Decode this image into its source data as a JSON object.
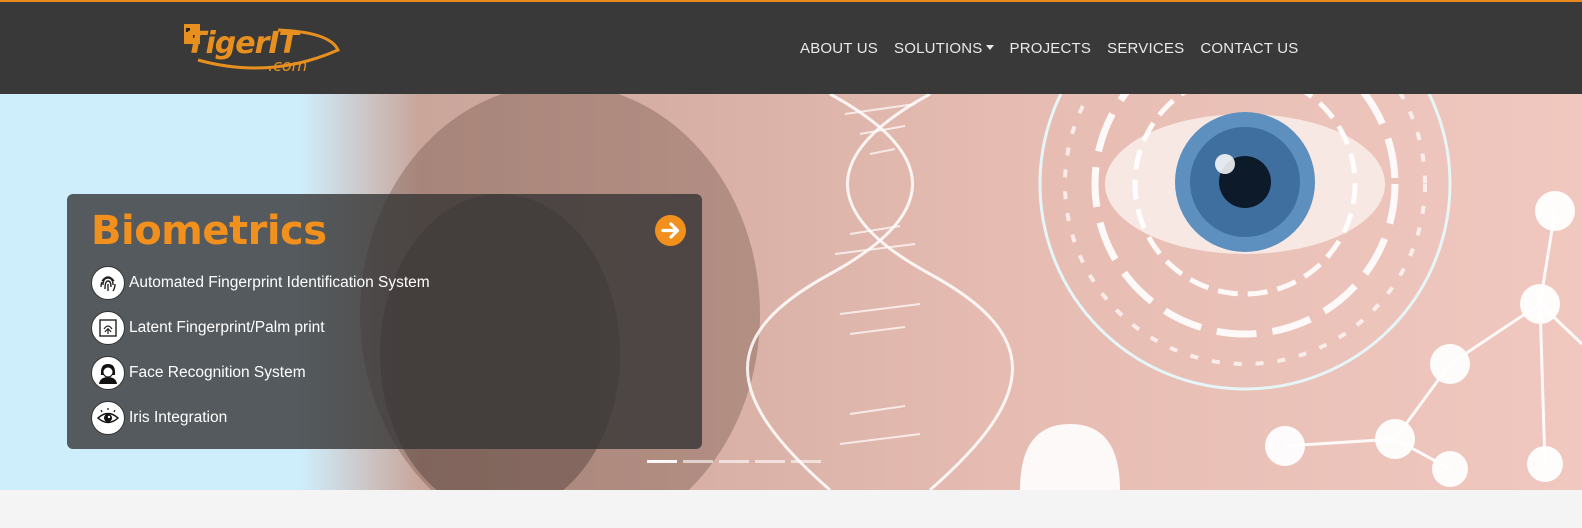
{
  "header": {
    "logo": {
      "text": "TigerIT",
      "sub": ".com"
    },
    "nav": [
      {
        "label": "ABOUT US"
      },
      {
        "label": "SOLUTIONS",
        "dropdown": true
      },
      {
        "label": "PROJECTS"
      },
      {
        "label": "SERVICES"
      },
      {
        "label": "CONTACT US"
      }
    ]
  },
  "hero": {
    "title": "Biometrics",
    "items": [
      {
        "label": "Automated Fingerprint Identification System",
        "icon": "fingerprint-icon"
      },
      {
        "label": "Latent Fingerprint/Palm print",
        "icon": "latent-print-icon"
      },
      {
        "label": "Face Recognition System",
        "icon": "face-icon"
      },
      {
        "label": "Iris Integration",
        "icon": "eye-icon"
      }
    ],
    "slides": 5,
    "active_slide": 1,
    "next_icon": "arrow-right-circle-icon"
  },
  "colors": {
    "accent": "#f2901e",
    "header_bg": "#393939",
    "top_border": "#e8871e"
  }
}
